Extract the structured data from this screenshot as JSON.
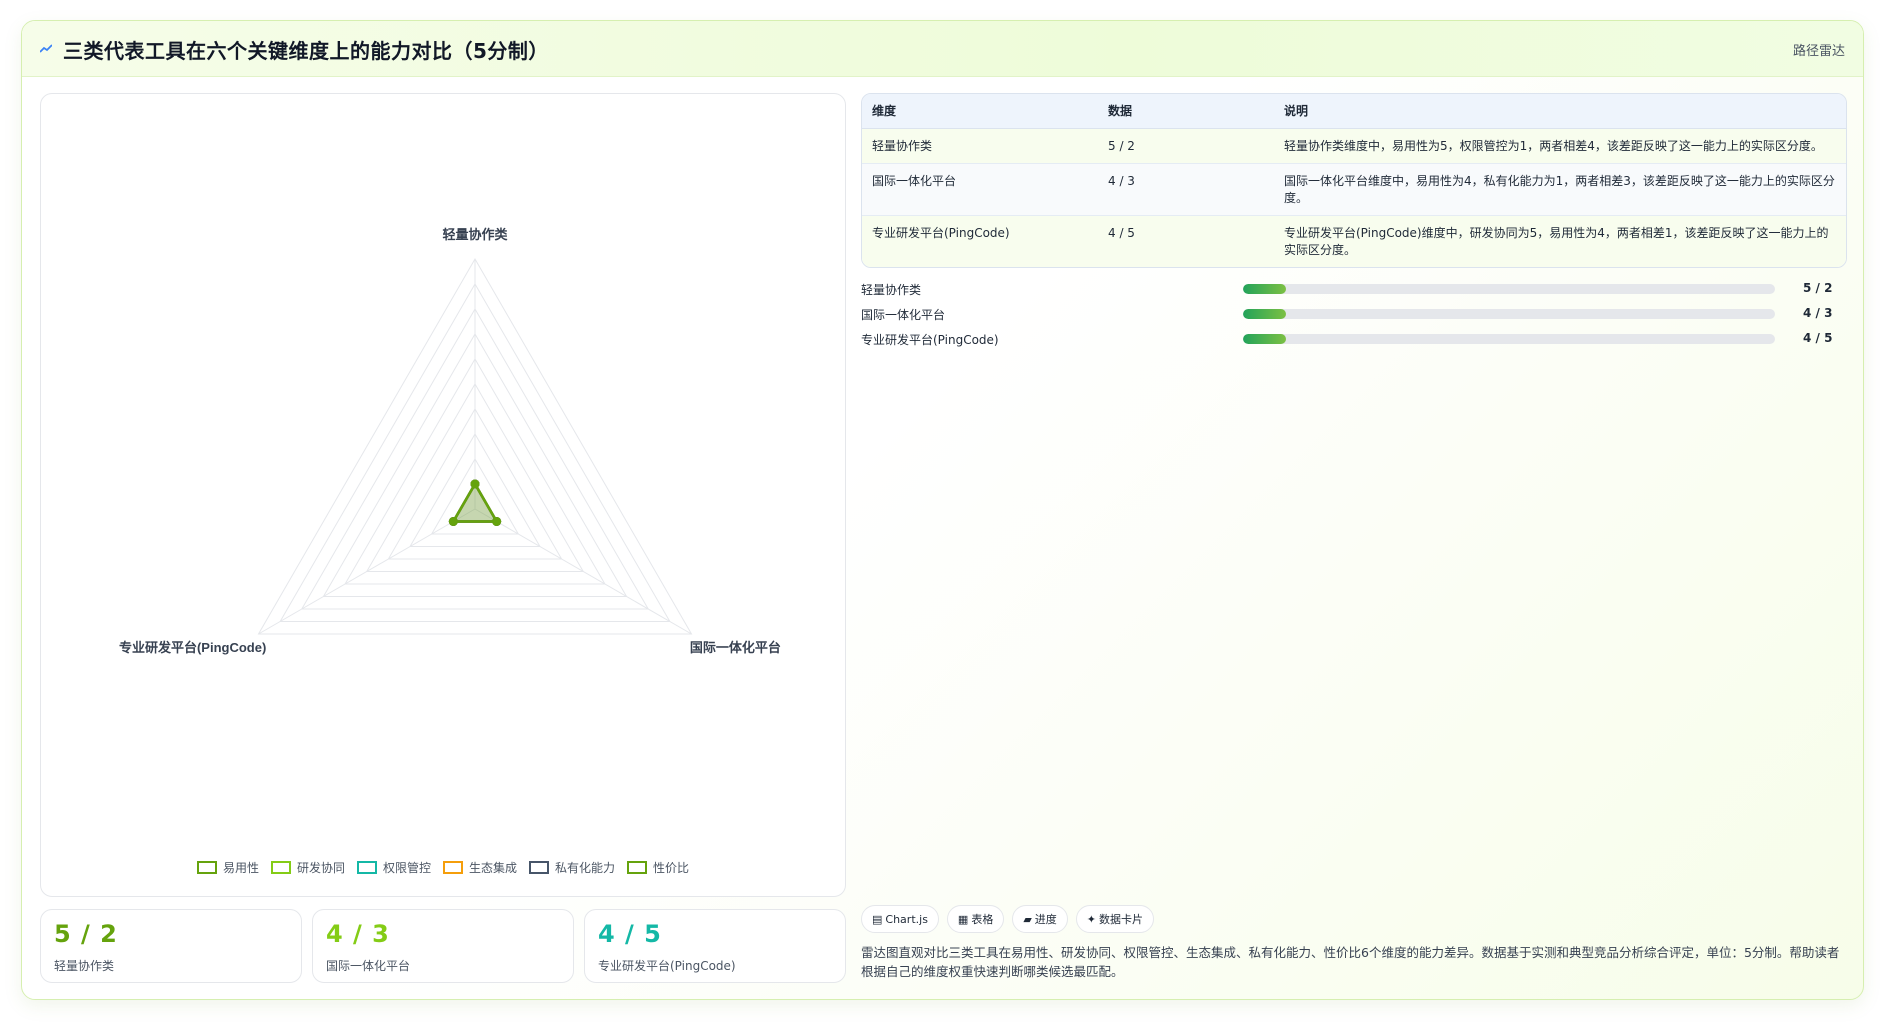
{
  "header": {
    "icon": "chart-line-icon",
    "title": "三类代表工具在六个关键维度上的能力对比（5分制）",
    "tag": "路径雷达"
  },
  "chart_data": {
    "type": "radar",
    "axes": [
      "轻量协作类",
      "国际一体化平台",
      "专业研发平台(PingCode)"
    ],
    "range": [
      0,
      5
    ],
    "grid": true,
    "legend_position": "bottom",
    "series": [
      {
        "name": "易用性",
        "values": [
          0.5,
          0.5,
          0.5
        ],
        "color": "#65a30d"
      },
      {
        "name": "研发协同",
        "values": [
          0.5,
          0.5,
          0.5
        ],
        "color": "#84cc16"
      },
      {
        "name": "权限管控",
        "values": [
          0.5,
          0.5,
          0.5
        ],
        "color": "#14b8a6"
      },
      {
        "name": "生态集成",
        "values": [
          0.5,
          0.5,
          0.5
        ],
        "color": "#f59e0b"
      },
      {
        "name": "私有化能力",
        "values": [
          0.5,
          0.5,
          0.5
        ],
        "color": "#475569"
      },
      {
        "name": "性价比",
        "values": [
          0.5,
          0.5,
          0.5
        ],
        "color": "#65a30d"
      }
    ]
  },
  "stats": [
    {
      "value": "5 / 2",
      "label": "轻量协作类",
      "color": "#65a30d"
    },
    {
      "value": "4 / 3",
      "label": "国际一体化平台",
      "color": "#84cc16"
    },
    {
      "value": "4 / 5",
      "label": "专业研发平台(PingCode)",
      "color": "#14b8a6"
    }
  ],
  "table": {
    "headers": [
      "维度",
      "数据",
      "说明"
    ],
    "rows": [
      [
        "轻量协作类",
        "5 / 2",
        "轻量协作类维度中，易用性为5，权限管控为1，两者相差4，该差距反映了这一能力上的实际区分度。"
      ],
      [
        "国际一体化平台",
        "4 / 3",
        "国际一体化平台维度中，易用性为4，私有化能力为1，两者相差3，该差距反映了这一能力上的实际区分度。"
      ],
      [
        "专业研发平台(PingCode)",
        "4 / 5",
        "专业研发平台(PingCode)维度中，研发协同为5，易用性为4，两者相差1，该差距反映了这一能力上的实际区分度。"
      ]
    ]
  },
  "progress": [
    {
      "label": "轻量协作类",
      "value": "5 / 2",
      "fraction": 0.08
    },
    {
      "label": "国际一体化平台",
      "value": "4 / 3",
      "fraction": 0.08
    },
    {
      "label": "专业研发平台(PingCode)",
      "value": "4 / 5",
      "fraction": 0.08
    }
  ],
  "chips": [
    {
      "icon": "chart-icon",
      "glyph": "▤",
      "label": "Chart.js"
    },
    {
      "icon": "table-icon",
      "glyph": "▦",
      "label": "表格"
    },
    {
      "icon": "progress-icon",
      "glyph": "▰",
      "label": "进度"
    },
    {
      "icon": "sparkle-icon",
      "glyph": "✦",
      "label": "数据卡片"
    }
  ],
  "description": "雷达图直观对比三类工具在易用性、研发协同、权限管控、生态集成、私有化能力、性价比6个维度的能力差异。数据基于实测和典型竞品分析综合评定，单位：5分制。帮助读者根据自己的维度权重快速判断哪类候选最匹配。"
}
